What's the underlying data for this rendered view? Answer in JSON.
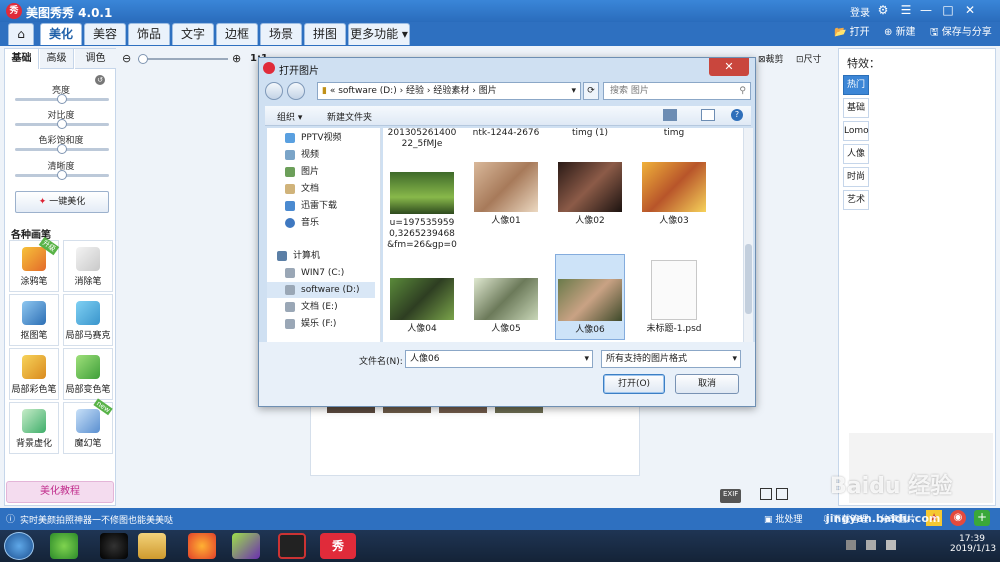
{
  "app": {
    "title": "美图秀秀 4.0.1",
    "login": "登录"
  },
  "tabs": [
    {
      "label": "美化"
    },
    {
      "label": "美容"
    },
    {
      "label": "饰品"
    },
    {
      "label": "文字"
    },
    {
      "label": "边框"
    },
    {
      "label": "场景"
    },
    {
      "label": "拼图"
    },
    {
      "label": "更多功能"
    }
  ],
  "toolbar": {
    "open": "打开",
    "new": "新建",
    "save_share": "保存与分享",
    "crop": "裁剪",
    "size": "尺寸"
  },
  "left_panel": {
    "subtabs": [
      "基础",
      "高级",
      "调色"
    ],
    "sliders": [
      {
        "label": "亮度",
        "value": 0.5
      },
      {
        "label": "对比度",
        "value": 0.5
      },
      {
        "label": "色彩饱和度",
        "value": 0.5
      },
      {
        "label": "清晰度",
        "value": 0.5
      }
    ],
    "one_click": "一键美化",
    "brushes_title": "各种画笔",
    "brushes": [
      {
        "label": "涂鸦笔",
        "badge": "升级"
      },
      {
        "label": "消除笔"
      },
      {
        "label": "抠图笔"
      },
      {
        "label": "局部马赛克"
      },
      {
        "label": "局部彩色笔"
      },
      {
        "label": "局部变色笔"
      },
      {
        "label": "背景虚化"
      },
      {
        "label": "魔幻笔",
        "badge": "new"
      }
    ],
    "tutorial": "美化教程"
  },
  "zoom": {
    "label": "1:1"
  },
  "right_panel": {
    "title": "特效：",
    "effects": [
      "热门",
      "基础",
      "Lomo",
      "人像",
      "时尚",
      "艺术"
    ]
  },
  "dialog": {
    "title": "打开图片",
    "close": "✕",
    "path": [
      "«",
      "software (D:)",
      "经验",
      "经验素材",
      "图片"
    ],
    "search_placeholder": "搜索 图片",
    "organize": "组织 ▾",
    "new_folder": "新建文件夹",
    "nav": [
      "PPTV视频",
      "视频",
      "图片",
      "文档",
      "迅雷下载",
      "音乐",
      "计算机",
      "WIN7 (C:)",
      "software (D:)",
      "文档 (E:)",
      "娱乐 (F:)"
    ],
    "files": [
      {
        "name": "20130526140022_5fMJe"
      },
      {
        "name": "ntk-1244-2676"
      },
      {
        "name": "timg (1)"
      },
      {
        "name": "timg"
      },
      {
        "name": "u=1975359590,3265239468&fm=26&gp=0"
      },
      {
        "name": "人像01"
      },
      {
        "name": "人像02"
      },
      {
        "name": "人像03"
      },
      {
        "name": "人像04"
      },
      {
        "name": "人像05"
      },
      {
        "name": "人像06"
      },
      {
        "name": "未标题-1.psd"
      }
    ],
    "filename_label": "文件名(N):",
    "filename_value": "人像06",
    "filetype": "所有支持的图片格式",
    "open_btn": "打开(O)",
    "cancel_btn": "取消"
  },
  "bottom": {
    "exif": "EXIF",
    "batch": "批处理",
    "download": "下载管理",
    "share": "分享图片"
  },
  "status": {
    "text": "实时美颜拍照神器一不修图也能美美哒"
  },
  "taskbar": {
    "time": "17:39",
    "date": "2019/1/13"
  },
  "watermark": "Baidu 经验",
  "watermark_sub": "jingyan.baidu.com"
}
